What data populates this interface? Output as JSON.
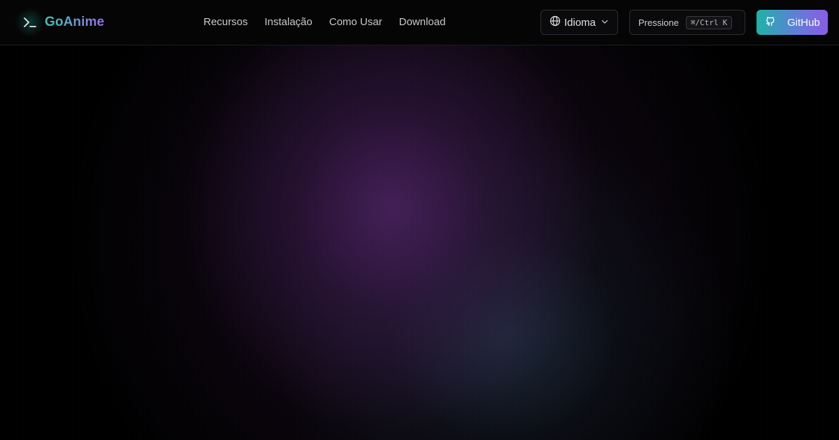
{
  "header": {
    "brand": {
      "icon": "terminal-icon",
      "name": "GoAnime"
    },
    "nav": [
      {
        "label": "Recursos"
      },
      {
        "label": "Instalação"
      },
      {
        "label": "Como Usar"
      },
      {
        "label": "Download"
      }
    ],
    "language": {
      "icon": "globe-icon",
      "label": "Idioma",
      "chevron": "chevron-down-icon"
    },
    "search": {
      "label": "Pressione",
      "shortcut": "⌘/Ctrl",
      "key": "K"
    },
    "github": {
      "icon": "github-icon",
      "label": "GitHub"
    }
  },
  "colors": {
    "background": "#000000",
    "brand_gradient_start": "#35c9b9",
    "brand_gradient_end": "#9a6ee8",
    "github_gradient_start": "#1fb3a8",
    "github_gradient_end": "#8b5ce6",
    "glow_purple": "#46205a",
    "glow_teal": "#28465a"
  }
}
